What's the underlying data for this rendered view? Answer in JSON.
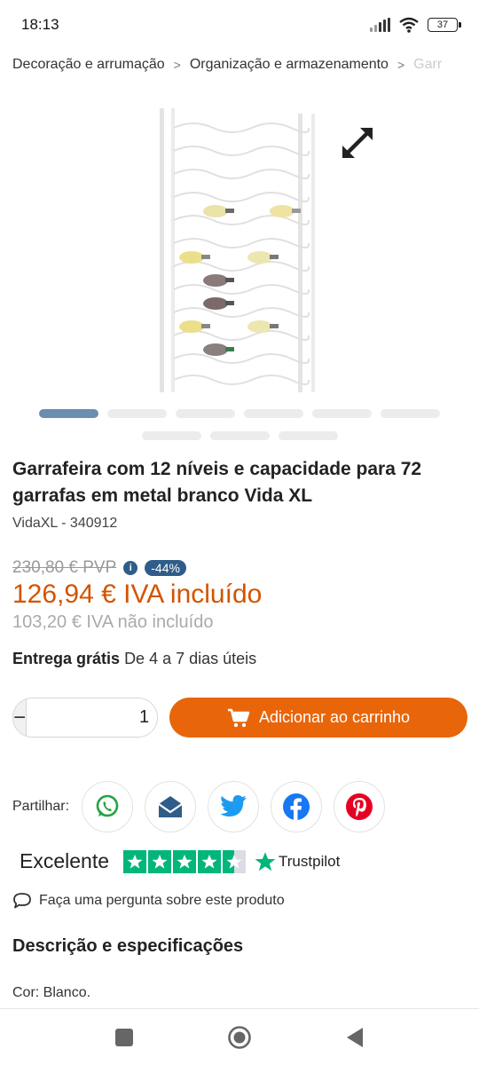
{
  "status": {
    "time": "18:13",
    "battery": "37"
  },
  "breadcrumb": {
    "items": [
      "Decoração e arrumação",
      "Organização e armazenamento",
      "Garr"
    ],
    "separator": ">"
  },
  "gallery": {
    "image_description_icon": "wine-rack-image",
    "expand_icon": "expand-arrows-icon",
    "slide_count": 9,
    "active_slide": 1
  },
  "product": {
    "title": "Garrafeira com 12 níveis e capacidade para 72 garrafas em metal branco Vida XL",
    "brand_sku": "VidaXL - 340912"
  },
  "pricing": {
    "old_price": "230,80 € PVP",
    "info_icon": "i",
    "discount": "-44%",
    "price": "126,94 €  IVA incluído",
    "price_net": "103,20 € IVA não incluído",
    "price_color": "#d35400",
    "badge_color": "#2f5d8a"
  },
  "delivery": {
    "label": "Entrega grátis",
    "text": "De 4 a 7 dias úteis"
  },
  "cart": {
    "minus": "−",
    "plus": "+",
    "quantity": "1",
    "add_label": "Adicionar ao carrinho",
    "button_color": "#e8650a"
  },
  "share": {
    "label": "Partilhar:",
    "networks": [
      "whatsapp-icon",
      "email-icon",
      "twitter-icon",
      "facebook-icon",
      "pinterest-icon"
    ]
  },
  "trustpilot": {
    "rating_label": "Excelente",
    "stars": 4.5,
    "brand": "Trustpilot",
    "color": "#00b67a"
  },
  "question": {
    "label": "Faça uma pergunta sobre este produto"
  },
  "description": {
    "title": "Descrição e especificações",
    "first_line": "Cor: Blanco."
  }
}
